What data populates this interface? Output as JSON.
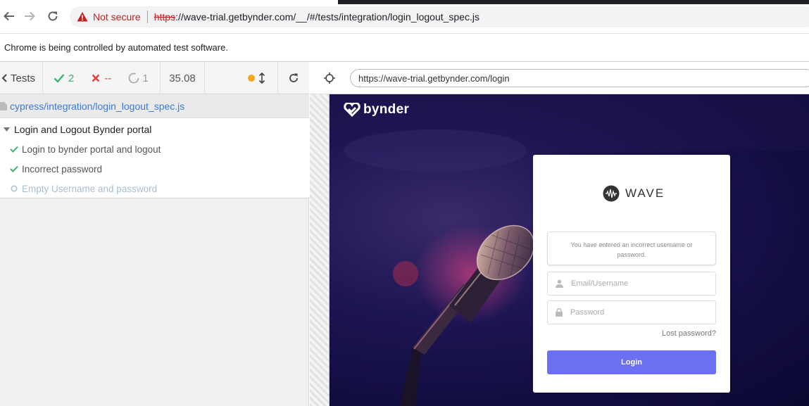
{
  "browser": {
    "security_label": "Not secure",
    "url_scheme": "https",
    "url_rest": "://wave-trial.getbynder.com/__/#/tests/integration/login_logout_spec.js"
  },
  "info_bar": {
    "message": "Chrome is being controlled by automated test software."
  },
  "reporter": {
    "tests_label": "Tests",
    "passed": "2",
    "failed": "--",
    "pending": "1",
    "duration": "35.08",
    "spec_file": "cypress/integration/login_logout_spec.js",
    "suite_title": "Login and Logout Bynder portal",
    "tests": [
      {
        "title": "Login to bynder portal and logout",
        "state": "passed"
      },
      {
        "title": "Incorrect password",
        "state": "passed"
      },
      {
        "title": "Empty Username and password",
        "state": "pending"
      }
    ],
    "colors": {
      "passed": "#3cb371",
      "failed": "#e0413b",
      "pending": "#a6bfd6",
      "running": "#f5a623",
      "link": "#3a7bd5"
    }
  },
  "aut": {
    "url": "https://wave-trial.getbynder.com/login",
    "brand": "bynder",
    "card": {
      "logo_text": "WAVE",
      "error_message": "You have entered an incorrect username or password.",
      "email_placeholder": "Email/Username",
      "password_placeholder": "Password",
      "lost_password": "Lost password?",
      "login_button": "Login",
      "accent": "#6b6ff2"
    }
  }
}
